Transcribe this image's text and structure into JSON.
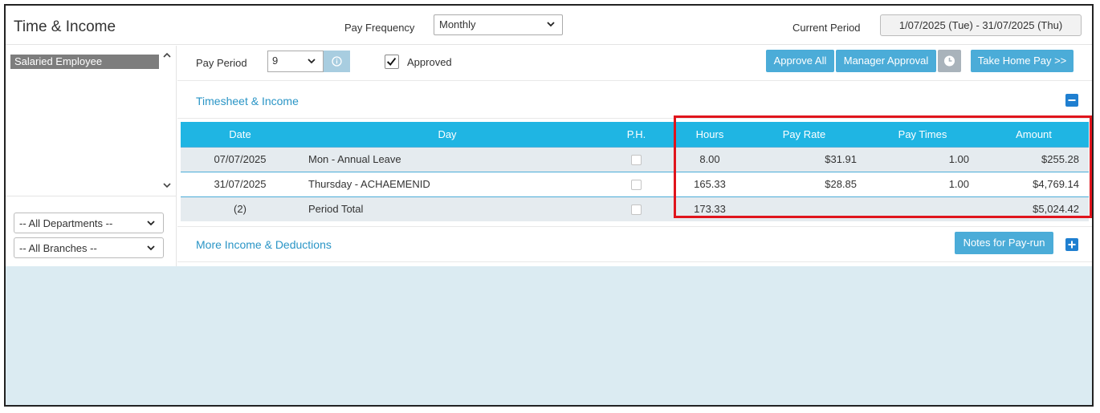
{
  "header": {
    "title": "Time & Income",
    "pay_frequency_label": "Pay Frequency",
    "pay_frequency_value": "Monthly",
    "current_period_label": "Current Period",
    "current_period_value": "1/07/2025 (Tue) - 31/07/2025 (Thu)"
  },
  "sidebar": {
    "employees": [
      "Salaried Employee"
    ],
    "department_filter": "-- All Departments --",
    "branch_filter": "-- All Branches --"
  },
  "toolbar": {
    "pay_period_label": "Pay Period",
    "pay_period_value": "9",
    "approved_label": "Approved",
    "approved_checked": true,
    "approve_all": "Approve All",
    "manager_approval": "Manager Approval",
    "take_home_pay": "Take Home Pay >>"
  },
  "timesheet": {
    "title": "Timesheet & Income",
    "columns": [
      "Date",
      "Day",
      "P.H.",
      "Hours",
      "Pay Rate",
      "Pay Times",
      "Amount"
    ],
    "rows": [
      {
        "date": "07/07/2025",
        "day": "Mon - Annual Leave",
        "hours": "8.00",
        "rate": "$31.91",
        "times": "1.00",
        "amount": "$255.28"
      },
      {
        "date": "31/07/2025",
        "day": "Thursday - ACHAEMENID",
        "hours": "165.33",
        "rate": "$28.85",
        "times": "1.00",
        "amount": "$4,769.14"
      },
      {
        "date": "(2)",
        "day": "Period Total",
        "hours": "173.33",
        "rate": "",
        "times": "",
        "amount": "$5,024.42"
      }
    ]
  },
  "more": {
    "title": "More Income & Deductions",
    "notes_button": "Notes for Pay-run"
  },
  "colors": {
    "accent": "#4bacd8",
    "table_header": "#1fb5e3",
    "highlight": "#e0141c"
  }
}
